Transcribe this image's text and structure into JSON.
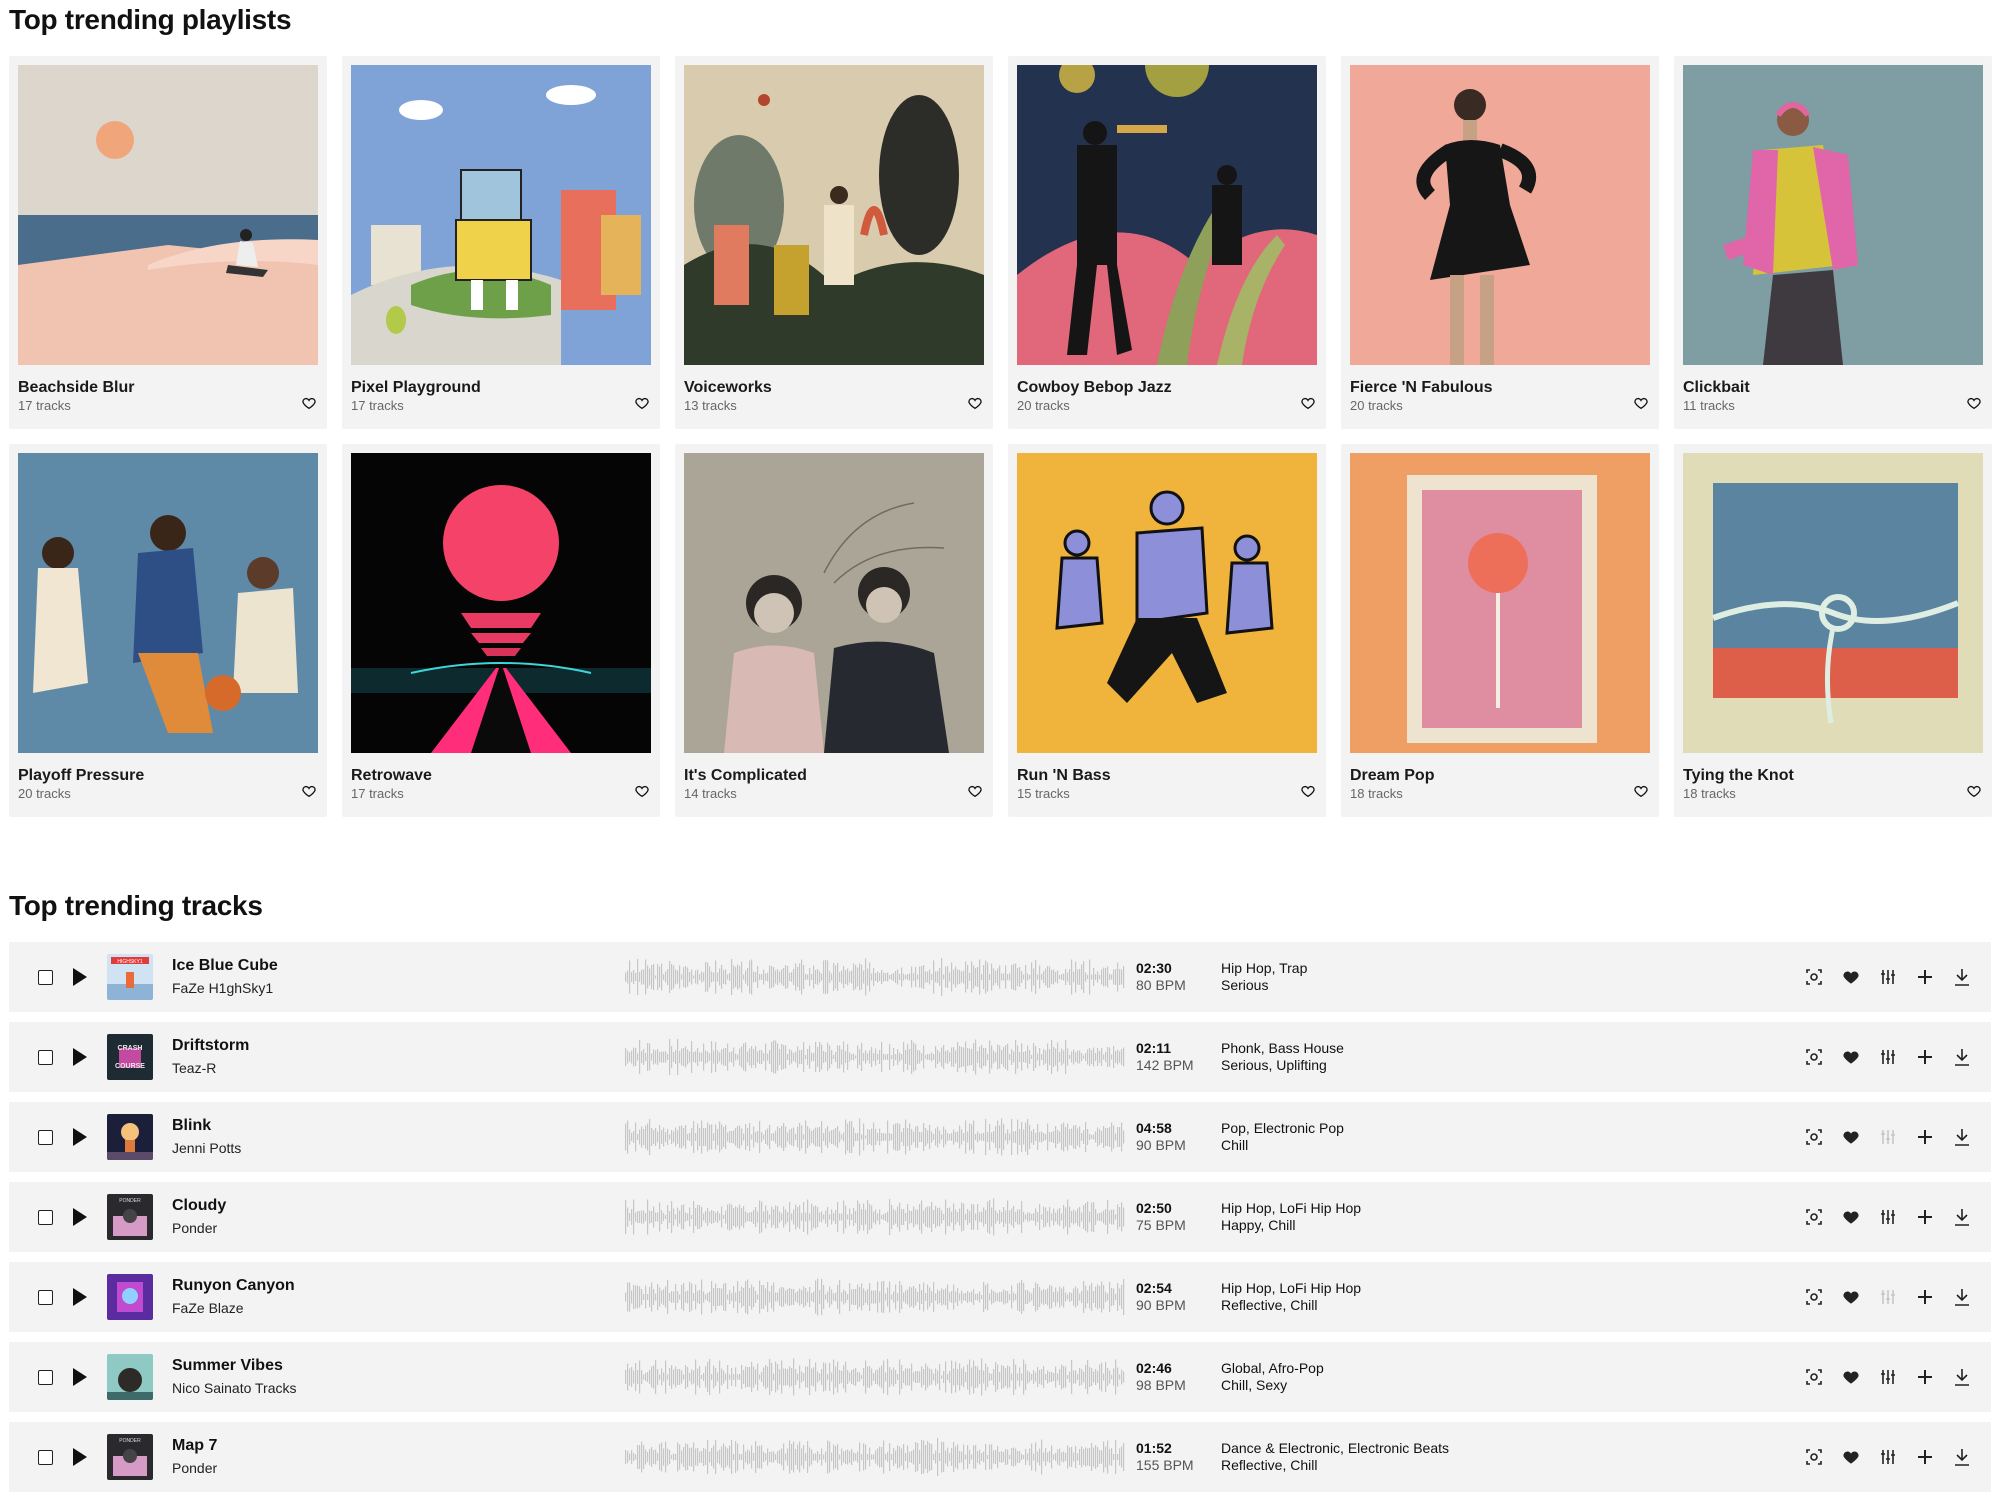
{
  "playlists_section": {
    "title": "Top trending playlists"
  },
  "tracks_section": {
    "title": "Top trending tracks"
  },
  "playlists": [
    {
      "title": "Beachside Blur",
      "count": "17 tracks"
    },
    {
      "title": "Pixel Playground",
      "count": "17 tracks"
    },
    {
      "title": "Voiceworks",
      "count": "13 tracks"
    },
    {
      "title": "Cowboy Bebop Jazz",
      "count": "20 tracks"
    },
    {
      "title": "Fierce 'N Fabulous",
      "count": "20 tracks"
    },
    {
      "title": "Clickbait",
      "count": "11 tracks"
    },
    {
      "title": "Playoff Pressure",
      "count": "20 tracks"
    },
    {
      "title": "Retrowave",
      "count": "17 tracks"
    },
    {
      "title": "It's Complicated",
      "count": "14 tracks"
    },
    {
      "title": "Run 'N Bass",
      "count": "15 tracks"
    },
    {
      "title": "Dream Pop",
      "count": "18 tracks"
    },
    {
      "title": "Tying the Knot",
      "count": "18 tracks"
    }
  ],
  "tracks": [
    {
      "title": "Ice Blue Cube",
      "artist": "FaZe H1ghSky1",
      "duration": "02:30",
      "bpm": "80 BPM",
      "genres": "Hip Hop, Trap",
      "moods": "Serious",
      "stems_available": true
    },
    {
      "title": "Driftstorm",
      "artist": "Teaz-R",
      "duration": "02:11",
      "bpm": "142 BPM",
      "genres": "Phonk, Bass House",
      "moods": "Serious, Uplifting",
      "stems_available": true
    },
    {
      "title": "Blink",
      "artist": "Jenni Potts",
      "duration": "04:58",
      "bpm": "90 BPM",
      "genres": "Pop, Electronic Pop",
      "moods": "Chill",
      "stems_available": false
    },
    {
      "title": "Cloudy",
      "artist": "Ponder",
      "duration": "02:50",
      "bpm": "75 BPM",
      "genres": "Hip Hop, LoFi Hip Hop",
      "moods": "Happy, Chill",
      "stems_available": true
    },
    {
      "title": "Runyon Canyon",
      "artist": "FaZe Blaze",
      "duration": "02:54",
      "bpm": "90 BPM",
      "genres": "Hip Hop, LoFi Hip Hop",
      "moods": "Reflective, Chill",
      "stems_available": false
    },
    {
      "title": "Summer Vibes",
      "artist": "Nico Sainato Tracks",
      "duration": "02:46",
      "bpm": "98 BPM",
      "genres": "Global, Afro-Pop",
      "moods": "Chill, Sexy",
      "stems_available": true
    },
    {
      "title": "Map 7",
      "artist": "Ponder",
      "duration": "01:52",
      "bpm": "155 BPM",
      "genres": "Dance & Electronic, Electronic Beats",
      "moods": "Reflective, Chill",
      "stems_available": true
    }
  ],
  "thumb_text": {
    "t0": "HIGHSKY1",
    "t1a": "CRASH",
    "t1b": "COURSE",
    "t3": "PONDER",
    "t6": "PONDER"
  },
  "icons": [
    "heart-icon",
    "play-icon",
    "similar-search-icon",
    "stems-icon",
    "add-icon",
    "download-icon"
  ],
  "colors": {
    "card_bg": "#f3f3f3",
    "waveform": "#c6c6c6",
    "text": "#111111",
    "muted": "#666666"
  }
}
